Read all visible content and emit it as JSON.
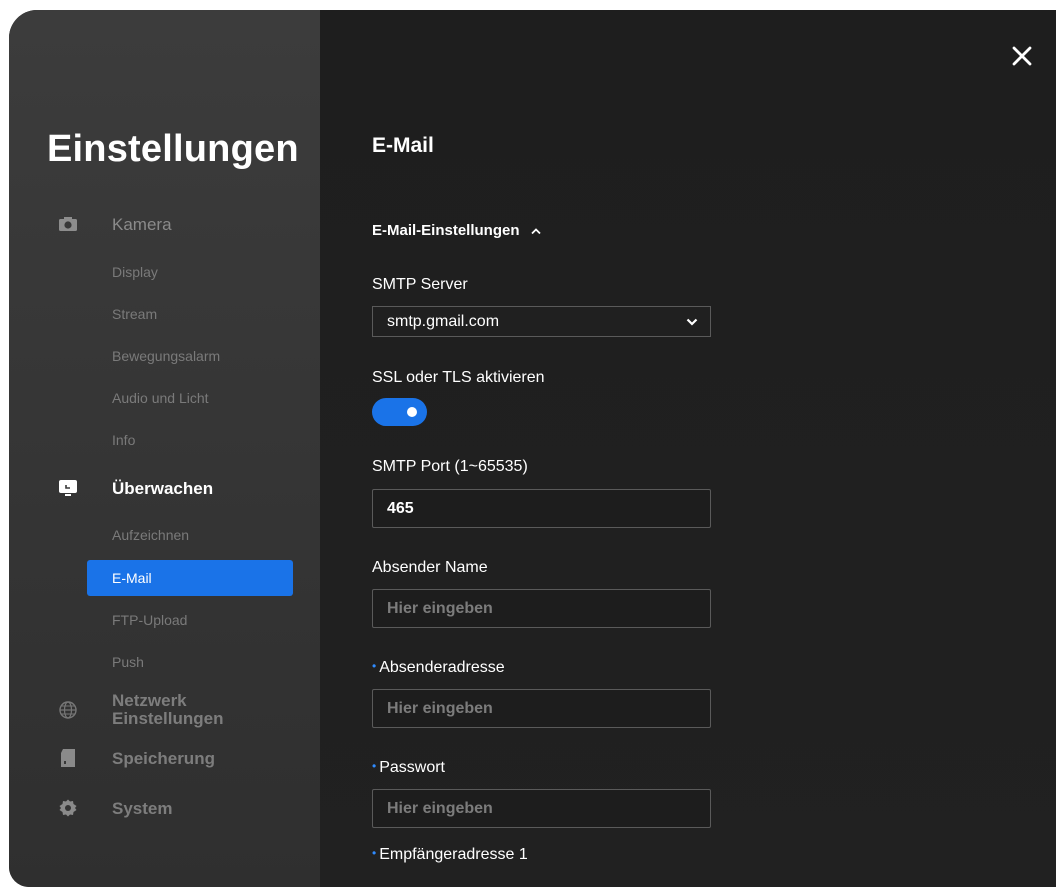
{
  "sidebar": {
    "title": "Einstellungen",
    "groups": [
      {
        "label": "Kamera",
        "icon": "camera-icon"
      },
      {
        "label": "Überwachen",
        "icon": "monitor-icon"
      },
      {
        "label": "Netzwerk Einstellungen",
        "icon": "globe-icon"
      },
      {
        "label": "Speicherung",
        "icon": "storage-icon"
      },
      {
        "label": "System",
        "icon": "gear-icon"
      }
    ],
    "camera_items": [
      "Display",
      "Stream",
      "Bewegungsalarm",
      "Audio und Licht",
      "Info"
    ],
    "monitor_items": [
      "Aufzeichnen",
      "E-Mail",
      "FTP-Upload",
      "Push"
    ],
    "network_line1": "Netzwerk",
    "network_line2": "Einstellungen"
  },
  "main": {
    "title": "E-Mail",
    "section_title": "E-Mail-Einstellungen",
    "smtp_server_label": "SMTP Server",
    "smtp_server_value": "smtp.gmail.com",
    "ssl_label": "SSL oder TLS aktivieren",
    "ssl_enabled": true,
    "smtp_port_label": "SMTP Port (1~65535)",
    "smtp_port_value": "465",
    "sender_name_label": "Absender Name",
    "sender_address_label": "Absenderadresse",
    "password_label": "Passwort",
    "recipient_label": "Empfängeradresse 1",
    "placeholder": "Hier eingeben",
    "required_marker": "•"
  },
  "colors": {
    "accent": "#1a73e8",
    "sidebar_bg": "#383838",
    "main_bg": "#1f1f1f"
  }
}
